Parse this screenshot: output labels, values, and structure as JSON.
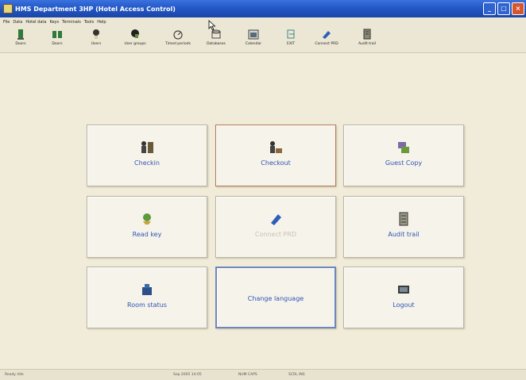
{
  "window": {
    "title": "HMS Department 3HP (Hotel Access Control)",
    "buttons": [
      "_",
      "□",
      "×"
    ]
  },
  "menu": [
    "File",
    "Data",
    "Hotel data",
    "Keys",
    "Terminals",
    "Tools",
    "Help"
  ],
  "toolbar": [
    {
      "label": "Doors",
      "icon": "door-icon"
    },
    {
      "label": "Doors",
      "icon": "double-door-icon"
    },
    {
      "label": "Users",
      "icon": "user-icon"
    },
    {
      "label": "User groups",
      "icon": "user-group-icon"
    },
    {
      "label": "Timed periods",
      "icon": "timer-icon"
    },
    {
      "label": "Databases",
      "icon": "database-icon"
    },
    {
      "label": "Calendar",
      "icon": "calendar-icon"
    },
    {
      "label": "EXIT",
      "icon": "exit-icon"
    },
    {
      "label": "Connect PRD",
      "icon": "connect-icon"
    },
    {
      "label": "Audit trail",
      "icon": "audit-icon"
    }
  ],
  "main": [
    {
      "label": "Checkin",
      "icon": "checkin-icon",
      "state": "normal"
    },
    {
      "label": "Checkout",
      "icon": "checkout-icon",
      "state": "focused"
    },
    {
      "label": "Guest Copy",
      "icon": "guest-copy-icon",
      "state": "normal"
    },
    {
      "label": "Read key",
      "icon": "read-key-icon",
      "state": "normal"
    },
    {
      "label": "Connect PRD",
      "icon": "connect-icon",
      "state": "disabled"
    },
    {
      "label": "Audit trail",
      "icon": "audit-trail-icon",
      "state": "normal"
    },
    {
      "label": "Room status",
      "icon": "room-status-icon",
      "state": "normal"
    },
    {
      "label": "Change language",
      "icon": "",
      "state": "selected"
    },
    {
      "label": "Logout",
      "icon": "logout-icon",
      "state": "normal"
    }
  ],
  "status": [
    "Ready   Idle",
    "Sep 2005  14:05",
    "NUM  CAPS",
    "SCRL  INS"
  ],
  "colors": {
    "titlebar": "#2358c7",
    "background": "#f1ecd9",
    "button_label": "#2f55b5",
    "disabled_label": "#c7c3b6"
  }
}
